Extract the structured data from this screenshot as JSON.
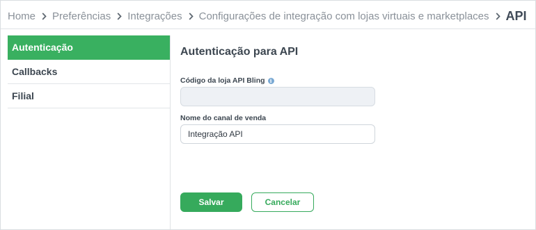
{
  "breadcrumb": {
    "items": [
      "Home",
      "Preferências",
      "Integrações",
      "Configurações de integração com lojas virtuais e marketplaces"
    ],
    "current": "API",
    "separator_icon": "chevron-right-icon"
  },
  "sidebar": {
    "items": [
      {
        "label": "Autenticação",
        "active": true
      },
      {
        "label": "Callbacks",
        "active": false
      },
      {
        "label": "Filial",
        "active": false
      }
    ]
  },
  "main": {
    "title": "Autenticação para API",
    "fields": [
      {
        "label": "Código da loja API Bling",
        "value": "",
        "has_info_icon": true,
        "disabled": true
      },
      {
        "label": "Nome do canal de venda",
        "value": "Integração API",
        "has_info_icon": false,
        "disabled": false
      }
    ],
    "buttons": {
      "save": "Salvar",
      "cancel": "Cancelar"
    }
  },
  "colors": {
    "accent": "#36aa5c",
    "active_nav": "#39b060",
    "info_icon": "#7aa9d3"
  }
}
